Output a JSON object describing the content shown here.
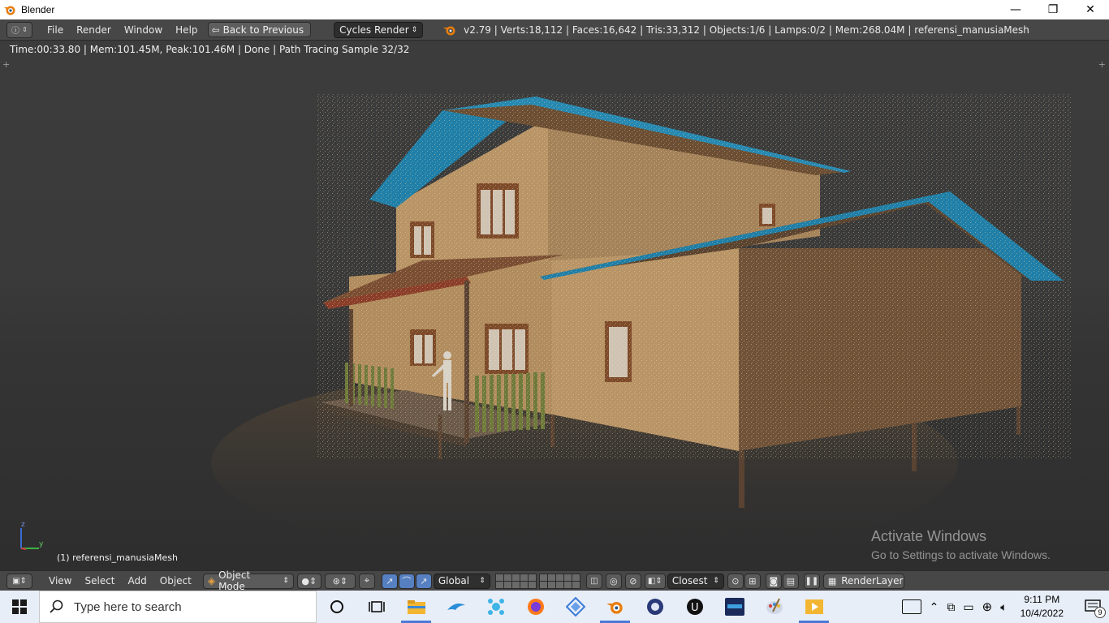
{
  "window": {
    "title": "Blender",
    "minimize": "—",
    "maximize": "❐",
    "close": "✕"
  },
  "info": {
    "menus": [
      "File",
      "Render",
      "Window",
      "Help"
    ],
    "back_label": "Back to Previous",
    "engine": "Cycles Render",
    "stats": "v2.79 | Verts:18,112 | Faces:16,642 | Tris:33,312 | Objects:1/6 | Lamps:0/2 | Mem:268.04M | referensi_manusiaMesh"
  },
  "viewport": {
    "render_status": "Time:00:33.80 | Mem:101.45M, Peak:101.46M | Done | Path Tracing Sample 32/32",
    "object_label": "(1) referensi_manusiaMesh",
    "axis_z": "z",
    "axis_y": "y",
    "activate_title": "Activate Windows",
    "activate_sub": "Go to Settings to activate Windows."
  },
  "view_header": {
    "menus": [
      "View",
      "Select",
      "Add",
      "Object"
    ],
    "mode": "Object Mode",
    "orientation": "Global",
    "snap_target": "Closest",
    "render_layer": "RenderLayer"
  },
  "taskbar": {
    "search_placeholder": "Type here to search",
    "time": "9:11 PM",
    "date": "10/4/2022",
    "notification_count": "9"
  },
  "colors": {
    "blender_orange": "#e87d0d",
    "roof_blue": "#1f7fa8",
    "wall_tan": "#b89466",
    "taskbar_bg": "#e8eef8"
  }
}
